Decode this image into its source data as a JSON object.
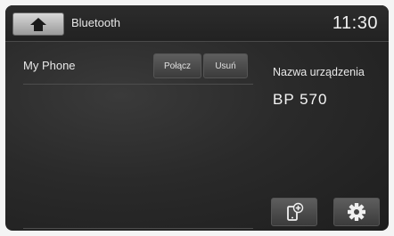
{
  "header": {
    "title": "Bluetooth",
    "time": "11:30"
  },
  "paired_devices": [
    {
      "name": "My Phone",
      "connect_label": "Połącz",
      "delete_label": "Usuń"
    }
  ],
  "device_info": {
    "label": "Nazwa urządzenia",
    "value": "BP 570"
  },
  "icons": {
    "home": "home-icon",
    "add_device": "add-phone-icon",
    "settings": "gear-icon"
  }
}
